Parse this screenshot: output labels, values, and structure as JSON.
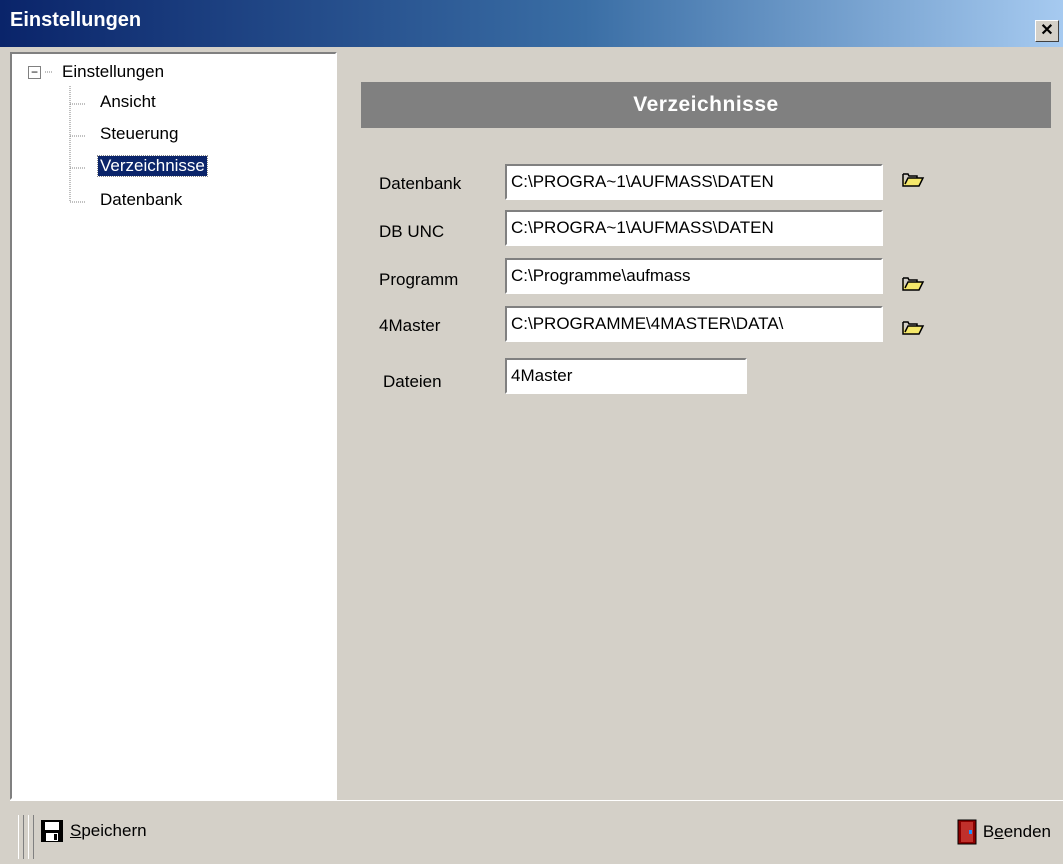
{
  "window": {
    "title": "Einstellungen",
    "close_glyph": "✕"
  },
  "tree": {
    "expander": "−",
    "root": "Einstellungen",
    "items": [
      {
        "label": "Ansicht",
        "selected": false
      },
      {
        "label": "Steuerung",
        "selected": false
      },
      {
        "label": "Verzeichnisse",
        "selected": true
      },
      {
        "label": "Datenbank",
        "selected": false
      }
    ]
  },
  "panel": {
    "header": "Verzeichnisse",
    "rows": [
      {
        "label": "Datenbank",
        "value": "C:\\PROGRA~1\\AUFMASS\\DATEN",
        "browse_icon": "folder-open-icon"
      },
      {
        "label": "DB UNC",
        "value": "C:\\PROGRA~1\\AUFMASS\\DATEN"
      },
      {
        "label": "Programm",
        "value": "C:\\Programme\\aufmass",
        "browse_icon": "folder-open-icon"
      },
      {
        "label": "4Master",
        "value": "C:\\PROGRAMME\\4MASTER\\DATA\\",
        "browse_icon": "folder-open-icon"
      },
      {
        "label": "Dateien",
        "value": "4Master"
      }
    ]
  },
  "toolbar": {
    "save_underline": "S",
    "save_rest": "peichern",
    "exit_first": "B",
    "exit_underline": "e",
    "exit_rest": "enden",
    "save_icon": "floppy-disk-icon",
    "exit_icon": "door-exit-icon"
  },
  "colors": {
    "selection": "#0a246a",
    "header_bar": "#808080",
    "folder": "#f5e86b"
  }
}
